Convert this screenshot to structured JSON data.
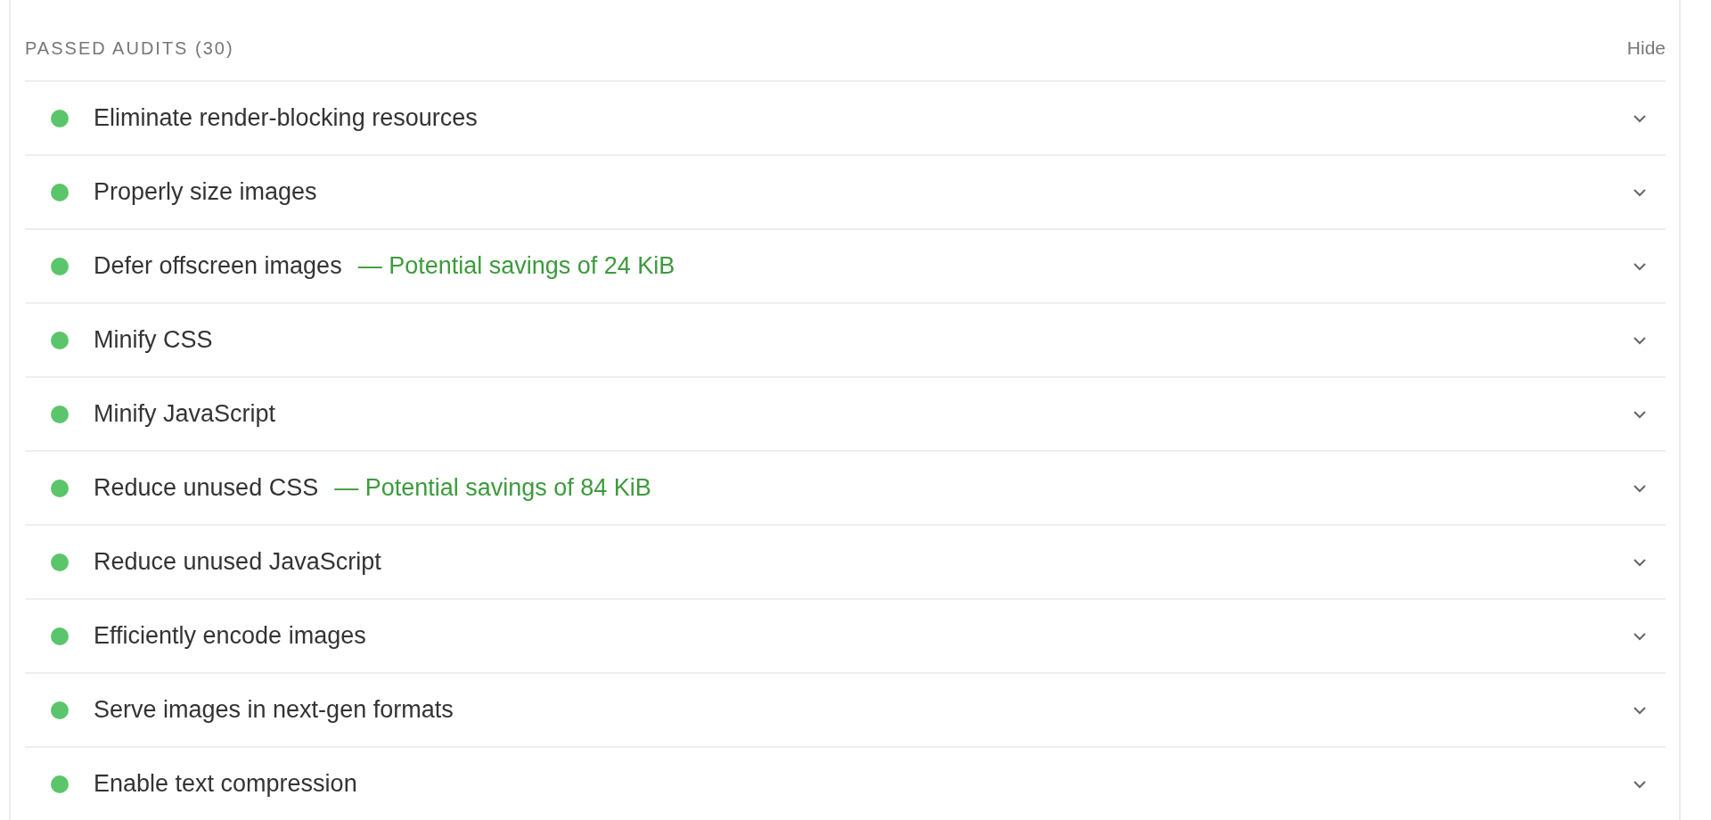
{
  "section": {
    "title": "PASSED AUDITS",
    "count": "(30)",
    "toggle": "Hide",
    "expanded": true
  },
  "audits": [
    {
      "title": "Eliminate render-blocking resources",
      "color": "#5bc56b",
      "expanded": false
    },
    {
      "title": "Properly size images",
      "color": "#5bc56b",
      "expanded": false
    },
    {
      "title": "Defer offscreen images",
      "savings": "— Potential savings of 24 KiB",
      "color": "#5bc56b",
      "expanded": false
    },
    {
      "title": "Minify CSS",
      "color": "#5bc56b",
      "expanded": false
    },
    {
      "title": "Minify JavaScript",
      "color": "#5bc56b",
      "expanded": false
    },
    {
      "title": "Reduce unused CSS",
      "savings": "— Potential savings of 84 KiB",
      "color": "#5bc56b",
      "expanded": false
    },
    {
      "title": "Reduce unused JavaScript",
      "color": "#5bc56b",
      "expanded": false
    },
    {
      "title": "Efficiently encode images",
      "color": "#5bc56b",
      "expanded": false
    },
    {
      "title": "Serve images in next-gen formats",
      "color": "#5bc56b",
      "expanded": false
    },
    {
      "title": "Enable text compression",
      "color": "#5bc56b",
      "expanded": false
    }
  ]
}
